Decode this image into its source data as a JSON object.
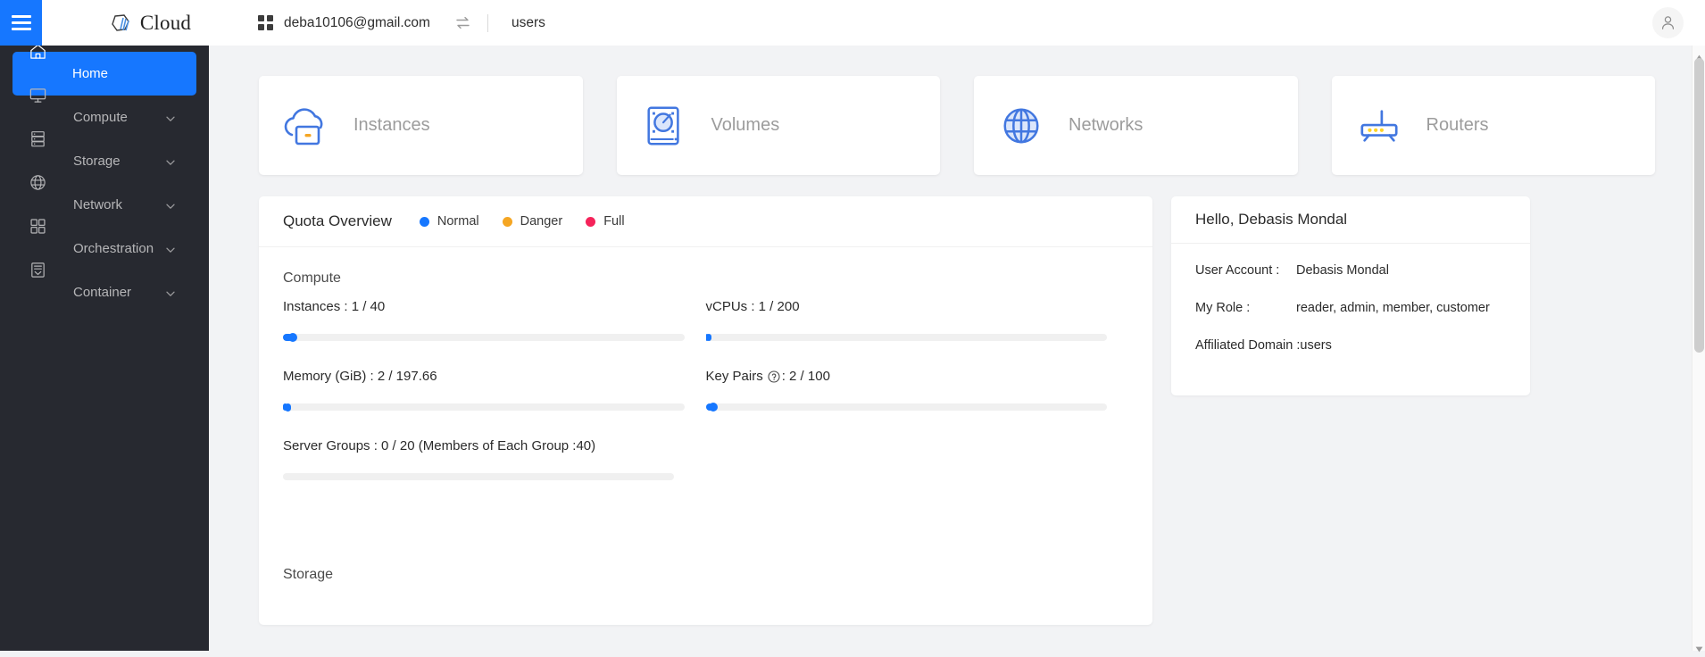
{
  "topbar": {
    "menu_toggle": "menu-toggle",
    "brand": "Cloud",
    "account": "deba10106@gmail.com",
    "domain": "users",
    "swap_icon": "swap-icon",
    "grid_icon": "grid-icon",
    "avatar_icon": "user-avatar-icon"
  },
  "sidebar": {
    "items": [
      {
        "label": "Home",
        "icon": "home-icon",
        "active": true,
        "caret": false
      },
      {
        "label": "Compute",
        "icon": "monitor-icon",
        "active": false,
        "caret": true
      },
      {
        "label": "Storage",
        "icon": "server-icon",
        "active": false,
        "caret": true
      },
      {
        "label": "Network",
        "icon": "globe-icon",
        "active": false,
        "caret": true
      },
      {
        "label": "Orchestration",
        "icon": "grid-squares-icon",
        "active": false,
        "caret": true
      },
      {
        "label": "Container",
        "icon": "container-box-icon",
        "active": false,
        "caret": true
      }
    ]
  },
  "resource_cards": [
    {
      "label": "Instances",
      "icon": "cloud-instance-icon"
    },
    {
      "label": "Volumes",
      "icon": "volume-disk-icon"
    },
    {
      "label": "Networks",
      "icon": "globe-network-icon"
    },
    {
      "label": "Routers",
      "icon": "router-icon"
    }
  ],
  "quota": {
    "title": "Quota Overview",
    "legend": [
      {
        "label": "Normal",
        "color": "#1677ff"
      },
      {
        "label": "Danger",
        "color": "#f5a623"
      },
      {
        "label": "Full",
        "color": "#f5235a"
      }
    ],
    "sections": [
      {
        "name": "Compute",
        "items": [
          {
            "label": "Instances : 1 / 40",
            "used": 1,
            "total": 40,
            "percent": 2.5,
            "help": false
          },
          {
            "label": "vCPUs : 1 / 200",
            "used": 1,
            "total": 200,
            "percent": 0.5,
            "help": false
          },
          {
            "label": "Memory (GiB) : 2 / 197.66",
            "used": 2,
            "total": 197.66,
            "percent": 1.01,
            "help": false
          },
          {
            "label": "Key Pairs",
            "suffix": ": 2 / 100",
            "used": 2,
            "total": 100,
            "percent": 2.0,
            "help": true
          },
          {
            "label": "Server Groups : 0 / 20 (Members of Each Group :40)",
            "used": 0,
            "total": 20,
            "percent": 0,
            "help": false,
            "full_width": true
          }
        ]
      },
      {
        "name": "Storage",
        "items": []
      }
    ]
  },
  "hello": {
    "title": "Hello, Debasis Mondal",
    "rows": [
      {
        "key": "User Account :",
        "value": "Debasis Mondal"
      },
      {
        "key": "My Role :",
        "value": "reader, admin, member, customer"
      },
      {
        "key": "Affiliated Domain :",
        "value": "users"
      }
    ]
  },
  "colors": {
    "accent": "#1677ff",
    "sidebar_bg": "#272930",
    "page_bg": "#f2f3f5",
    "danger": "#f5a623",
    "full": "#f5235a"
  }
}
